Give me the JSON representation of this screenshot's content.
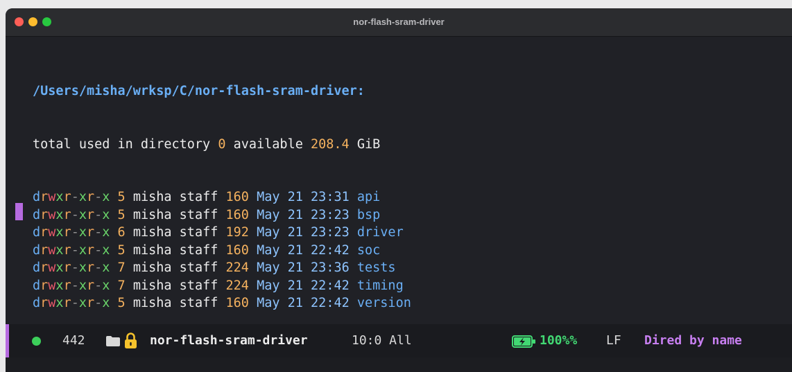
{
  "window": {
    "title": "nor-flash-sram-driver"
  },
  "buffer": {
    "header": "/Users/misha/wrksp/C/nor-flash-sram-driver:",
    "total_line": {
      "label_before": "total used in directory",
      "used": "0",
      "label_mid": "available",
      "available": "208.4",
      "unit": "GiB"
    },
    "entries": [
      {
        "perms": "drwxr-xr-x",
        "links": "5",
        "owner": "misha",
        "group": "staff",
        "size": "160",
        "date": "May 21 23:31",
        "name": "api"
      },
      {
        "perms": "drwxr-xr-x",
        "links": "5",
        "owner": "misha",
        "group": "staff",
        "size": "160",
        "date": "May 21 23:23",
        "name": "bsp"
      },
      {
        "perms": "drwxr-xr-x",
        "links": "6",
        "owner": "misha",
        "group": "staff",
        "size": "192",
        "date": "May 21 23:23",
        "name": "driver"
      },
      {
        "perms": "drwxr-xr-x",
        "links": "5",
        "owner": "misha",
        "group": "staff",
        "size": "160",
        "date": "May 21 22:42",
        "name": "soc"
      },
      {
        "perms": "drwxr-xr-x",
        "links": "7",
        "owner": "misha",
        "group": "staff",
        "size": "224",
        "date": "May 21 23:36",
        "name": "tests"
      },
      {
        "perms": "drwxr-xr-x",
        "links": "7",
        "owner": "misha",
        "group": "staff",
        "size": "224",
        "date": "May 21 22:42",
        "name": "timing"
      },
      {
        "perms": "drwxr-xr-x",
        "links": "5",
        "owner": "misha",
        "group": "staff",
        "size": "160",
        "date": "May 21 22:42",
        "name": "version"
      }
    ]
  },
  "modeline": {
    "count": "442",
    "folder_icon": "folder-icon",
    "lock_icon": "lock-icon",
    "buffer_name": "nor-flash-sram-driver",
    "position": "10:0 All",
    "battery_icon": "battery-charging-icon",
    "battery_percent": "100%%",
    "eol": "LF",
    "major_mode": "Dired by name"
  },
  "colors": {
    "accent_purple": "#b66be0",
    "status_green": "#3ccf5a",
    "dir_blue": "#6aaff5",
    "number_orange": "#f5b25f"
  }
}
